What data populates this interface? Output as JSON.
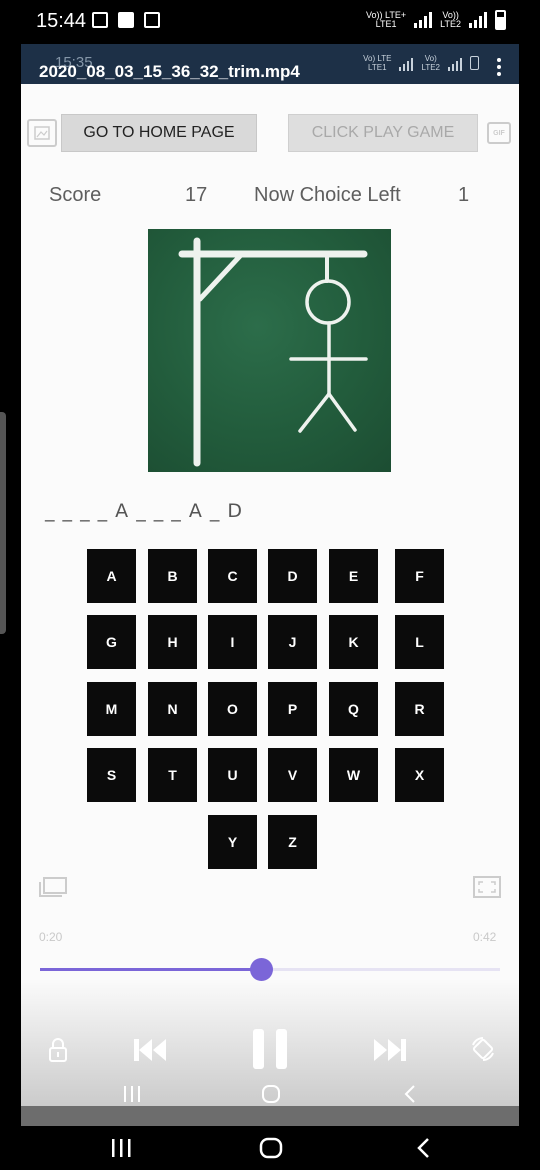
{
  "status_bar": {
    "time": "15:44",
    "network": [
      "Vo)) LTE+",
      "LTE1",
      "Vo))",
      "LTE2"
    ]
  },
  "player": {
    "ghost_time": "15:35",
    "file_title": "2020_08_03_15_36_32_trim.mp4",
    "header_network": [
      "Vo) LTE",
      "LTE1",
      "Vo)",
      "LTE2"
    ],
    "time_elapsed": "0:20",
    "time_total": "0:42",
    "progress": 0.48
  },
  "app": {
    "home_button_label": "GO TO HOME PAGE",
    "play_button_label": "CLICK PLAY GAME",
    "gif_label": "GIF",
    "score_label": "Score",
    "score_value": "17",
    "choice_label": "Now Choice Left",
    "choice_value": "1",
    "word_display": "_ _ _ _ A _ _ _ A _ D",
    "keyboard": [
      [
        "A",
        "B",
        "C",
        "D",
        "E",
        "F"
      ],
      [
        "G",
        "H",
        "I",
        "J",
        "K",
        "L"
      ],
      [
        "M",
        "N",
        "O",
        "P",
        "Q",
        "R"
      ],
      [
        "S",
        "T",
        "U",
        "V",
        "W",
        "X"
      ],
      [
        "Y",
        "Z"
      ]
    ]
  },
  "icons": {
    "screenshot": "screenshot-icon",
    "gif": "gif-icon",
    "popup": "popup-play-icon",
    "fullscreen": "fullscreen-icon",
    "lock": "lock-icon",
    "previous": "previous-icon",
    "pause": "pause-icon",
    "next": "next-icon",
    "rotate": "rotate-icon"
  },
  "colors": {
    "accent": "#7b66d8",
    "header": "#1d3047",
    "chalkboard": "#225c3c",
    "key_bg": "#0b0b0b"
  }
}
